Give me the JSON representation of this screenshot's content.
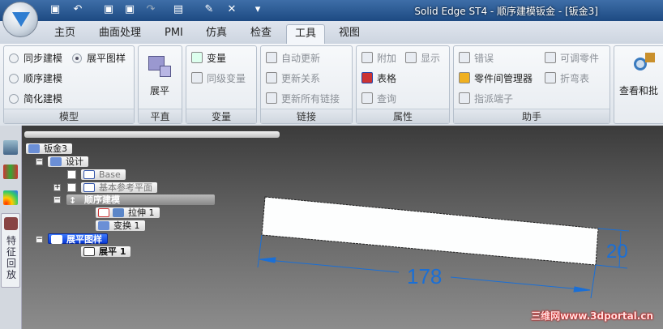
{
  "window": {
    "title": "Solid Edge ST4 - 顺序建模钣金 - [钣金3]"
  },
  "tabs": [
    "主页",
    "曲面处理",
    "PMI",
    "仿真",
    "检查",
    "工具",
    "视图"
  ],
  "active_tab": "工具",
  "ribbon": {
    "model": {
      "label": "模型",
      "sync": "同步建模",
      "flat": "展平图样",
      "ordered": "顺序建模",
      "simplify": "简化建模",
      "selected": "展平图样"
    },
    "flatten": {
      "label": "平直",
      "button": "展平"
    },
    "variables": {
      "label": "变量",
      "var": "变量",
      "peer": "同级变量"
    },
    "links": {
      "label": "链接",
      "auto": "自动更新",
      "rel": "更新关系",
      "all": "更新所有链接"
    },
    "props": {
      "label": "属性",
      "attach": "附加",
      "show": "显示",
      "table": "表格",
      "query": "查询"
    },
    "assist": {
      "label": "助手",
      "errors": "错误",
      "adjustable": "可调零件",
      "ipm": "零件间管理器",
      "bend_table": "折弯表",
      "assign": "指派端子"
    },
    "review": {
      "button": "查看和批"
    }
  },
  "sidebar": {
    "feature_playback": "特征回放"
  },
  "tree": {
    "root": "钣金3",
    "design": "设计",
    "base": "Base",
    "ref_planes": "基本参考平面",
    "ordered": "顺序建模",
    "extrude": "拉伸 1",
    "transform": "变换 1",
    "flat_pattern": "展平图样",
    "flatten": "展平 1"
  },
  "viewport": {
    "dim_length": "178",
    "dim_width": "20",
    "dim_color": "#1a6fd6"
  },
  "watermark": "三维网www.3dportal.cn"
}
